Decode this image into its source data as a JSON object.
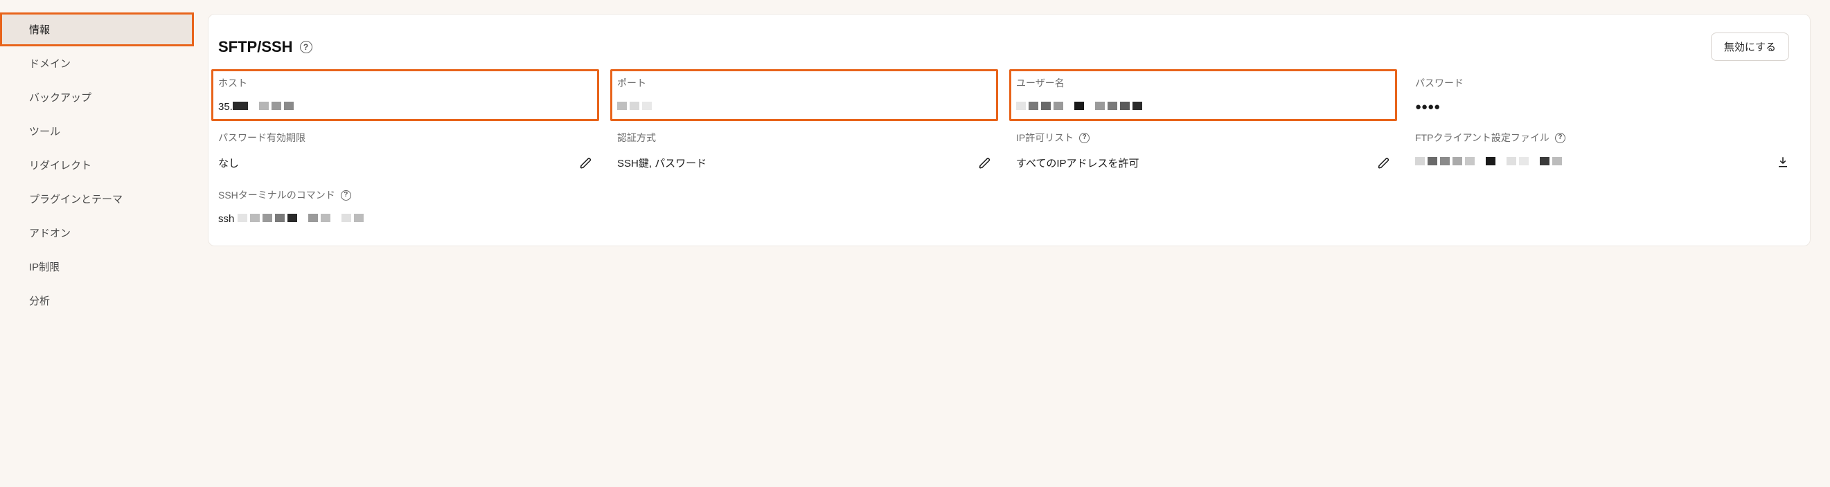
{
  "sidebar": {
    "items": [
      {
        "label": "情報",
        "active": true
      },
      {
        "label": "ドメイン",
        "active": false
      },
      {
        "label": "バックアップ",
        "active": false
      },
      {
        "label": "ツール",
        "active": false
      },
      {
        "label": "リダイレクト",
        "active": false
      },
      {
        "label": "プラグインとテーマ",
        "active": false
      },
      {
        "label": "アドオン",
        "active": false
      },
      {
        "label": "IP制限",
        "active": false
      },
      {
        "label": "分析",
        "active": false
      }
    ]
  },
  "panel": {
    "title": "SFTP/SSH",
    "disable_label": "無効にする"
  },
  "fields": {
    "host": {
      "label": "ホスト",
      "value_prefix": "35."
    },
    "port": {
      "label": "ポート"
    },
    "username": {
      "label": "ユーザー名"
    },
    "password": {
      "label": "パスワード",
      "value": "●●●●"
    },
    "pw_expiry": {
      "label": "パスワード有効期限",
      "value": "なし"
    },
    "auth": {
      "label": "認証方式",
      "value": "SSH鍵, パスワード"
    },
    "ip_allow": {
      "label": "IP許可リスト",
      "value": "すべてのIPアドレスを許可"
    },
    "ftp_conf": {
      "label": "FTPクライアント設定ファイル"
    },
    "ssh_cmd": {
      "label": "SSHターミナルのコマンド",
      "value_prefix": "ssh"
    }
  }
}
